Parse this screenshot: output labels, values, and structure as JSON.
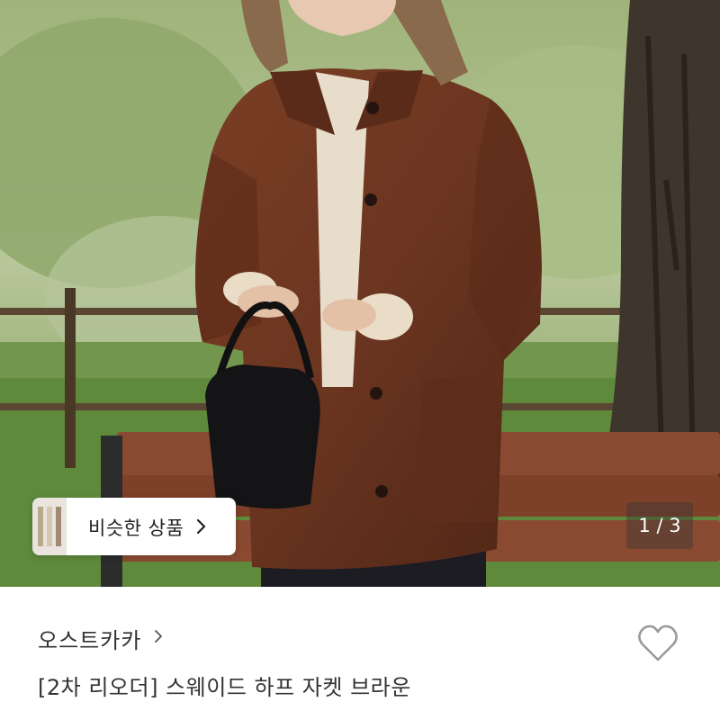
{
  "hero": {
    "image_description_icon": "product-photo",
    "page_counter": "1 / 3"
  },
  "similar_products": {
    "label": "비슷한 상품",
    "chevron_icon": "chevron-right-icon"
  },
  "product": {
    "seller": "오스트카카",
    "title": "[2차 리오더] 스웨이드 하프 자켓 브라운",
    "like_icon": "heart-outline-icon"
  },
  "colors": {
    "jacket": "#6b3520",
    "text_primary": "#333333",
    "heart_stroke": "#9a9a9a"
  }
}
